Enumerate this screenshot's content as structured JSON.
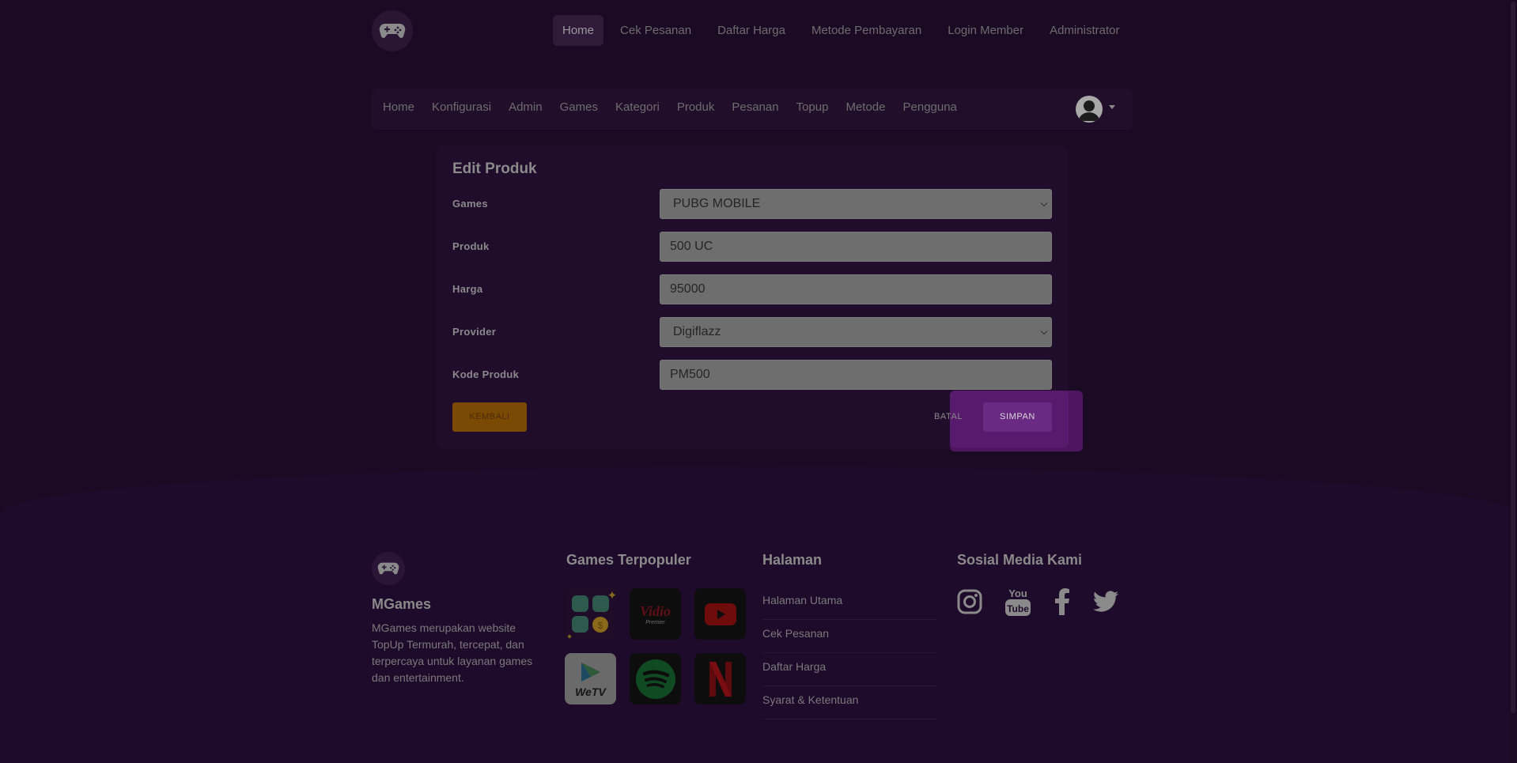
{
  "topnav": {
    "items": [
      {
        "label": "Home",
        "active": true
      },
      {
        "label": "Cek Pesanan"
      },
      {
        "label": "Daftar Harga"
      },
      {
        "label": "Metode Pembayaran"
      },
      {
        "label": "Login Member"
      },
      {
        "label": "Administrator"
      }
    ]
  },
  "adminnav": {
    "items": [
      "Home",
      "Konfigurasi",
      "Admin",
      "Games",
      "Kategori",
      "Produk",
      "Pesanan",
      "Topup",
      "Metode",
      "Pengguna"
    ]
  },
  "form": {
    "title": "Edit Produk",
    "games": {
      "label": "Games",
      "value": "PUBG MOBILE"
    },
    "produk": {
      "label": "Produk",
      "value": "500 UC"
    },
    "harga": {
      "label": "Harga",
      "value": "95000"
    },
    "provider": {
      "label": "Provider",
      "value": "Digiflazz"
    },
    "kode": {
      "label": "Kode Produk",
      "value": "PM500"
    },
    "kembali_label": "KEMBALI",
    "batal_label": "BATAL",
    "simpan_label": "SIMPAN"
  },
  "footer": {
    "brand": "MGames",
    "description": "MGames merupakan website TopUp Termurah, tercepat, dan terpercaya untuk layanan games dan entertainment.",
    "games_heading": "Games Terpopuler",
    "games": [
      {
        "name": "apps-icon"
      },
      {
        "name": "Vidio",
        "sub": "Premier"
      },
      {
        "name": "youtube-icon"
      },
      {
        "name": "WeTV"
      },
      {
        "name": "spotify-icon"
      },
      {
        "name": "netflix-icon"
      }
    ],
    "pages_heading": "Halaman",
    "pages": [
      "Halaman Utama",
      "Cek Pesanan",
      "Daftar Harga",
      "Syarat & Ketentuan"
    ],
    "social_heading": "Sosial Media Kami",
    "socials": [
      "instagram-icon",
      "youtube-icon",
      "facebook-icon",
      "twitter-icon"
    ]
  },
  "colors": {
    "background": "#1a0a24",
    "card": "#200d2c",
    "accent": "#6a2a84",
    "kembali": "#7a4a05"
  }
}
